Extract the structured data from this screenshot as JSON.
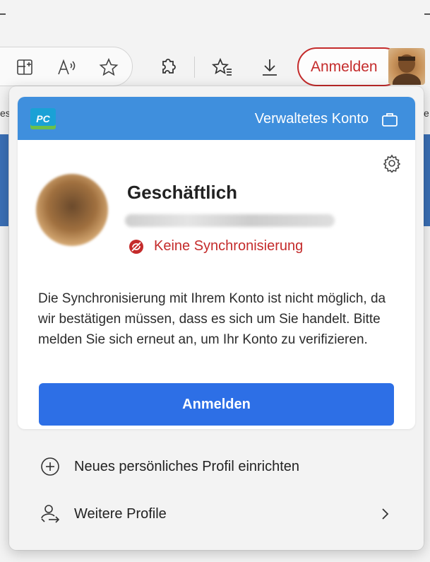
{
  "toolbar": {
    "icons": [
      "add-tab-icon",
      "read-aloud-icon",
      "favorite-star-icon",
      "extensions-icon",
      "favorites-list-icon",
      "download-icon"
    ],
    "signin_label": "Anmelden"
  },
  "background": {
    "left_edge_text": "es",
    "right_edge_text": "e"
  },
  "flyout": {
    "header": {
      "org_logo_text": "PC",
      "managed_label": "Verwaltetes Konto"
    },
    "profile": {
      "name": "Geschäftlich",
      "sync_status": "Keine Synchronisierung"
    },
    "description": "Die Synchronisierung mit Ihrem Konto ist nicht möglich, da wir bestätigen müssen, dass es sich um Sie handelt. Bitte melden Sie sich erneut an, um Ihr Konto zu verifizieren.",
    "signin_button": "Anmelden",
    "menu": {
      "new_profile": "Neues persönliches Profil einrichten",
      "more_profiles": "Weitere Profile"
    }
  },
  "colors": {
    "header_blue": "#3f8fdd",
    "button_blue": "#2d6fe6",
    "error_red": "#c42b2b"
  }
}
